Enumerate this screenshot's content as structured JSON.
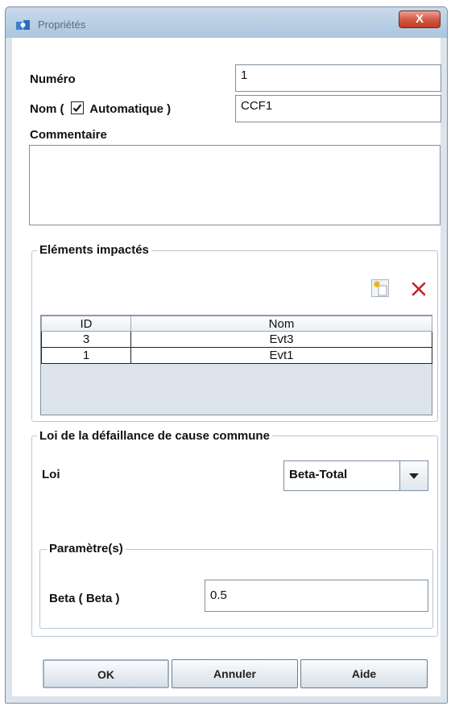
{
  "window": {
    "title": "Propriétés",
    "close_label": "X"
  },
  "fields": {
    "numero_label": "Numéro",
    "numero_value": "1",
    "nom_label_prefix": "Nom (",
    "nom_auto_label": "Automatique )",
    "nom_auto_checked": true,
    "nom_value": "CCF1",
    "commentaire_label": "Commentaire",
    "commentaire_value": ""
  },
  "impacted": {
    "title": "Eléments impactés",
    "columns": [
      "ID",
      "Nom"
    ],
    "rows": [
      {
        "id": "3",
        "nom": "Evt3"
      },
      {
        "id": "1",
        "nom": "Evt1"
      }
    ]
  },
  "law": {
    "title": "Loi de la défaillance de cause commune",
    "loi_label": "Loi",
    "loi_value": "Beta-Total",
    "params_title": "Paramètre(s)",
    "beta_label": "Beta ( Beta )",
    "beta_value": "0.5"
  },
  "buttons": {
    "ok": "OK",
    "cancel": "Annuler",
    "help": "Aide"
  },
  "colors": {
    "close": "#d2563f",
    "accent": "#b6cde3",
    "delete_icon": "#c0242a"
  },
  "icons": [
    "app-icon",
    "add-row-icon",
    "delete-row-icon",
    "dropdown-arrow-icon",
    "check-icon"
  ]
}
